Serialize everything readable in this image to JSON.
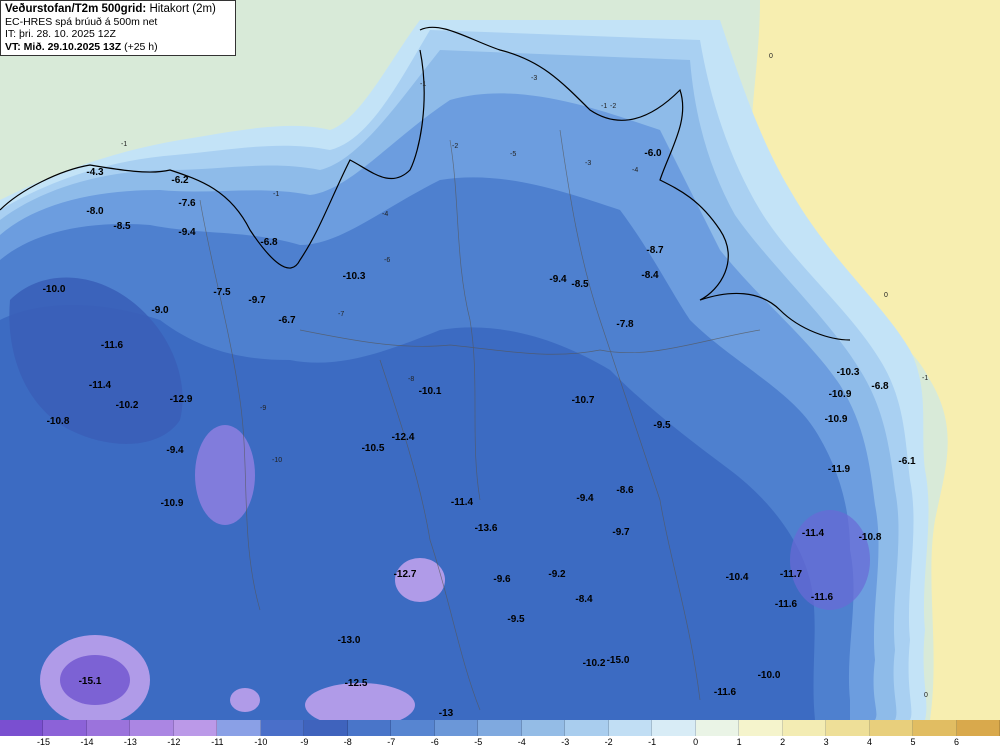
{
  "header": {
    "title_bold": "Veðurstofan/T2m 500grid:",
    "title_rest": "Hitakort (2m)",
    "line2": "EC-HRES spá brúuð á 500m net",
    "line3": "IT: þri. 28. 10. 2025 12Z",
    "vt_bold": "VT: Mið. 29.10.2025 13Z",
    "vt_rest": "(+25 h)"
  },
  "colors": {
    "sea": "#d8ead8",
    "warm": "#f7eeb0",
    "band_m1": "#c3e3f7",
    "band_m2": "#a9d0f2",
    "band_m3": "#8ebbe9",
    "band_m5": "#6c9ddf",
    "band_m7": "#4e80cf",
    "band_m9": "#3a67c0",
    "band_m11": "#8d7fe0",
    "band_m13": "#b09be8",
    "band_m15": "#7c62d4"
  },
  "legend": {
    "colors": [
      "#7a4fd0",
      "#8c62d8",
      "#9b73dc",
      "#ab86e3",
      "#bb99e8",
      "#8aa0e6",
      "#4a6fc9",
      "#3f63bd",
      "#4975c9",
      "#5785d1",
      "#6b97d8",
      "#7fa9df",
      "#94bce6",
      "#a9cdee",
      "#c1def4",
      "#d8ecf6",
      "#eaf4e6",
      "#f5f4cc",
      "#f3ecb3",
      "#eedf98",
      "#e8cf7c",
      "#e1bd62",
      "#d9a94c"
    ],
    "ticks": [
      "-15",
      "-14",
      "-13",
      "-12",
      "-11",
      "-10",
      "-9",
      "-8",
      "-7",
      "-6",
      "-5",
      "-4",
      "-3",
      "-2",
      "-1",
      "0",
      "1",
      "2",
      "3",
      "4",
      "5",
      "6"
    ]
  },
  "labels": [
    {
      "t": "-4.3"
    },
    {
      "t": "-8.0"
    },
    {
      "t": "-8.5"
    },
    {
      "t": "-10.0"
    },
    {
      "t": "-11.6"
    },
    {
      "t": "-9.0"
    },
    {
      "t": "-11.4"
    },
    {
      "t": "-10.2"
    },
    {
      "t": "-12.9"
    },
    {
      "t": "-10.8"
    },
    {
      "t": "-9.4"
    },
    {
      "t": "-10.9"
    },
    {
      "t": "-6.2"
    },
    {
      "t": "-7.6"
    },
    {
      "t": "-9.4"
    },
    {
      "t": "-6.8"
    },
    {
      "t": "-7.5"
    },
    {
      "t": "-9.7"
    },
    {
      "t": "-6.7"
    },
    {
      "t": "-10.3"
    },
    {
      "t": "-10.1"
    },
    {
      "t": "-12.4"
    },
    {
      "t": "-10.5"
    },
    {
      "t": "-11.4"
    },
    {
      "t": "-13.6"
    },
    {
      "t": "-12.7"
    },
    {
      "t": "-13.0"
    },
    {
      "t": "-15.1"
    },
    {
      "t": "-12.5"
    },
    {
      "t": "-13"
    },
    {
      "t": "-9.4"
    },
    {
      "t": "-8.5"
    },
    {
      "t": "-8.7"
    },
    {
      "t": "-8.4"
    },
    {
      "t": "-7.8"
    },
    {
      "t": "-6.0"
    },
    {
      "t": "-10.7"
    },
    {
      "t": "-9.5"
    },
    {
      "t": "-9.4"
    },
    {
      "t": "-8.6"
    },
    {
      "t": "-9.7"
    },
    {
      "t": "-9.6"
    },
    {
      "t": "-9.2"
    },
    {
      "t": "-8.4"
    },
    {
      "t": "-9.5"
    },
    {
      "t": "-10.2"
    },
    {
      "t": "-15.0"
    },
    {
      "t": "-10.3"
    },
    {
      "t": "-6.8"
    },
    {
      "t": "-10.9"
    },
    {
      "t": "-10.9"
    },
    {
      "t": "-11.9"
    },
    {
      "t": "-6.1"
    },
    {
      "t": "-11.4"
    },
    {
      "t": "-10.8"
    },
    {
      "t": "-10.4"
    },
    {
      "t": "-11.7"
    },
    {
      "t": "-11.6"
    },
    {
      "t": "-11.6"
    },
    {
      "t": "-10.0"
    },
    {
      "t": "-11.6"
    }
  ],
  "contour_labels": [
    "-1",
    "-1",
    "-1",
    "0",
    "0",
    "0",
    "-1",
    "-3",
    "-5",
    "-7",
    "-2",
    "-4",
    "-6",
    "-8",
    "-9",
    "-10",
    "-2",
    "-3",
    "-1",
    "-4"
  ]
}
